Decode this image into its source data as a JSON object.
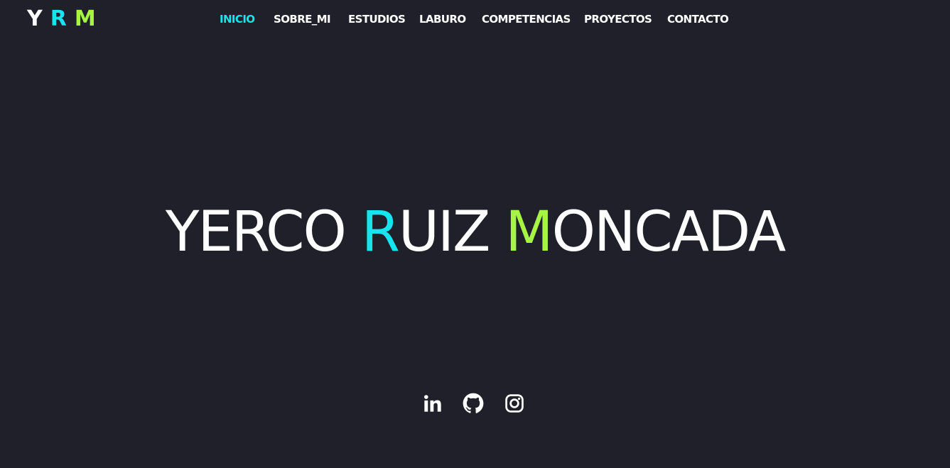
{
  "logo": {
    "letters": [
      "Y",
      "R",
      "M"
    ],
    "colors": [
      "#ffffff",
      "#16e4ee",
      "#a6f542"
    ]
  },
  "nav": {
    "items": [
      {
        "label": "INICIO",
        "active": true
      },
      {
        "label": "SOBRE_MI",
        "active": false
      },
      {
        "label": "ESTUDIOS",
        "active": false
      },
      {
        "label": "LABURO",
        "active": false
      },
      {
        "label": "COMPETENCIAS",
        "active": false
      },
      {
        "label": "PROYECTOS",
        "active": false
      },
      {
        "label": "CONTACTO",
        "active": false
      }
    ],
    "active_color": "#16e4ee",
    "text_color": "#ffffff"
  },
  "hero": {
    "part1": "YERCO ",
    "accent1": "R",
    "part2": "UIZ ",
    "accent2": "M",
    "part3": "ONCADA",
    "accent1_color": "#16e4ee",
    "accent2_color": "#a6f542"
  },
  "socials": [
    {
      "icon": "linkedin-icon"
    },
    {
      "icon": "github-icon"
    },
    {
      "icon": "instagram-icon"
    }
  ],
  "colors": {
    "background": "#20202a",
    "text": "#ffffff",
    "cyan": "#16e4ee",
    "green": "#a6f542"
  }
}
